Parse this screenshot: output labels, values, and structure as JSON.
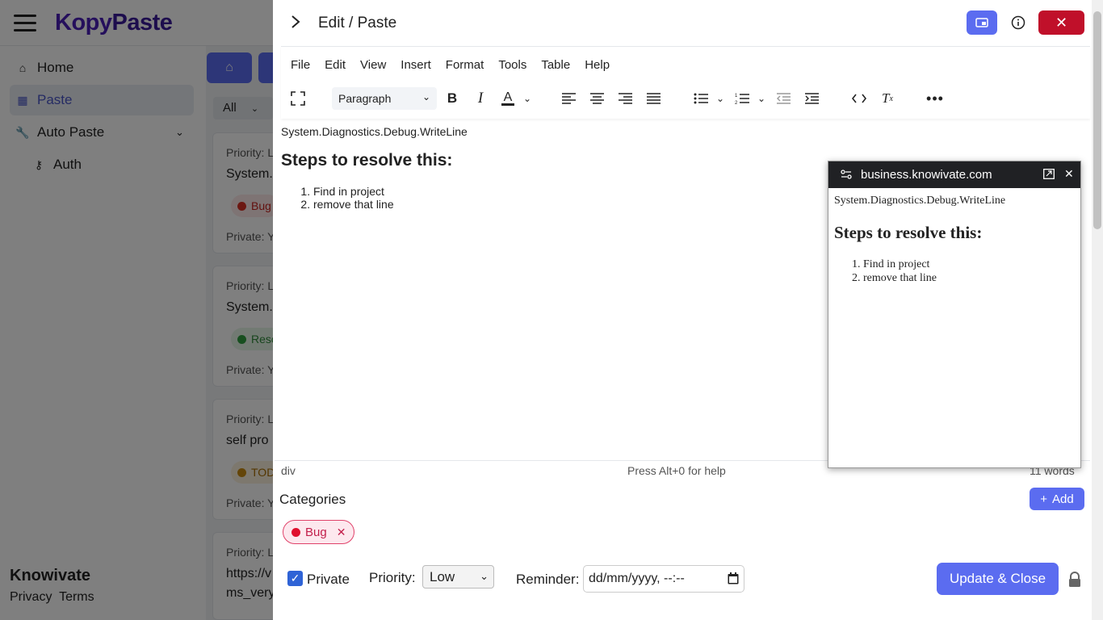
{
  "app": {
    "logo_part1": "Kopy",
    "logo_part2": "Paste",
    "nav": [
      {
        "label": "Home"
      },
      {
        "label": "Paste"
      },
      {
        "label": "Auto Paste"
      },
      {
        "label": "Auth"
      }
    ],
    "footer_brand": "Knowivate",
    "footer_privacy": "Privacy",
    "footer_terms": "Terms",
    "filter_value": "All",
    "cards": [
      {
        "priority": "Priority: L",
        "title": "System.",
        "badge": "Bug",
        "badge_color": "#d93025",
        "private": "Private: Y"
      },
      {
        "priority": "Priority: L",
        "title": "System.",
        "badge": "Reso",
        "badge_color": "#2e9e3e",
        "private": "Private: Y"
      },
      {
        "priority": "Priority: L",
        "title": "self pro",
        "badge": "TOD",
        "badge_color": "#c98a10",
        "private": "Private: Y"
      },
      {
        "priority": "Priority: L",
        "title": "https://v",
        "title2": "ms_very"
      }
    ]
  },
  "modal": {
    "title": "Edit / Paste",
    "menu": [
      "File",
      "Edit",
      "View",
      "Insert",
      "Format",
      "Tools",
      "Table",
      "Help"
    ],
    "block_format": "Paragraph",
    "content": {
      "line1": "System.Diagnostics.Debug.WriteLine",
      "heading": "Steps to resolve this:",
      "steps": [
        "Find in project",
        "remove that line"
      ]
    },
    "status_path": "div",
    "status_help": "Press Alt+0 for help",
    "word_count": "11 words",
    "categories_label": "Categories",
    "add_label": "Add",
    "category_chip": "Bug",
    "private_label": "Private",
    "priority_label": "Priority:",
    "priority_value": "Low",
    "reminder_label": "Reminder:",
    "reminder_placeholder": "dd/mm/yyyy, --:--",
    "update_label": "Update & Close",
    "colors": {
      "accent": "#5b6cf0",
      "danger": "#c0102a",
      "bug": "#e0426a"
    }
  },
  "popup": {
    "domain": "business.knowivate.com",
    "line1": "System.Diagnostics.Debug.WriteLine",
    "heading": "Steps to resolve this:",
    "steps": [
      "Find in project",
      "remove that line"
    ]
  }
}
